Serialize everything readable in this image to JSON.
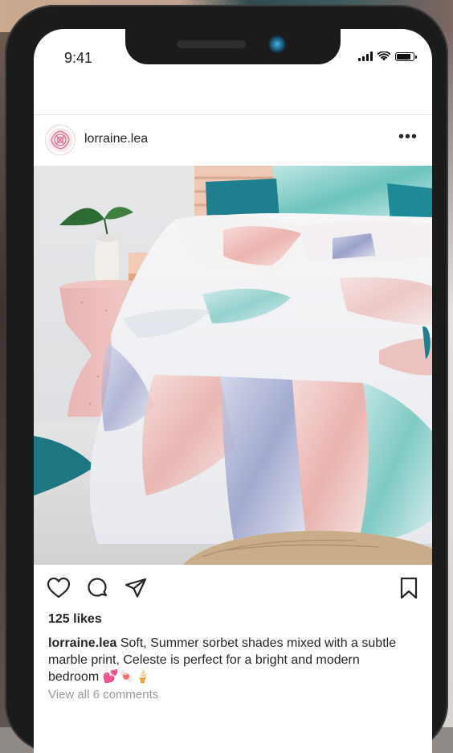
{
  "status": {
    "time": "9:41"
  },
  "post": {
    "username": "lorraine.lea",
    "more_glyph": "•••",
    "likes": "125 likes",
    "caption_user": "lorraine.lea",
    "caption_text": " Soft, Summer sorbet shades mixed with a subtle marble print, Celeste is perfect for a bright and modern bedroom 💕🍬🍦",
    "view_comments": "View all 6 comments"
  },
  "icons": {
    "like": "heart-icon",
    "comment": "comment-icon",
    "share": "paper-plane-icon",
    "save": "bookmark-icon"
  },
  "colors": {
    "text": "#262626",
    "muted": "#9a9a9a",
    "frame": "#1b1b1b",
    "accent_teal": "#1f7f8e",
    "pink": "#e89aa6"
  }
}
